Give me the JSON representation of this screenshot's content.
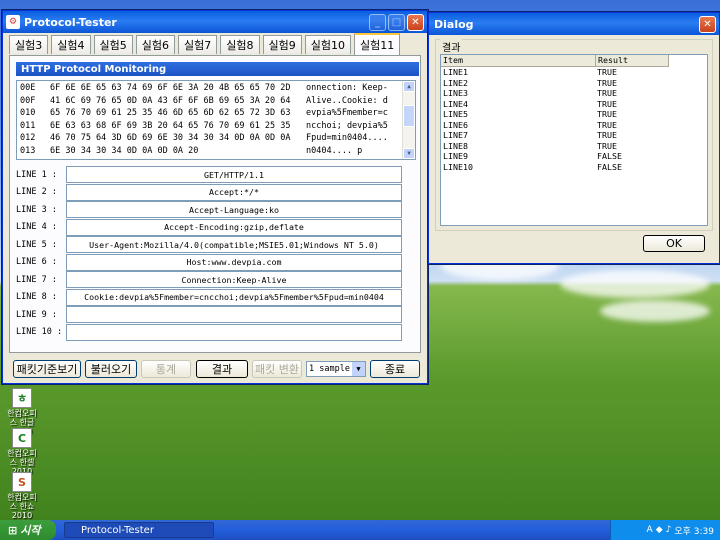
{
  "main_window": {
    "title": "Protocol-Tester",
    "tabs": [
      "실험3",
      "실험4",
      "실험5",
      "실험6",
      "실험7",
      "실험8",
      "실험9",
      "실험10",
      "실험11"
    ],
    "active_tab": 8,
    "monitor_title": "HTTP Protocol Monitoring",
    "hex_rows": [
      {
        "off": "00E",
        "bytes": "6F 6E 6E 65 63 74 69 6F 6E 3A 20 4B 65 65 70 2D",
        "ascii": "onnection: Keep-"
      },
      {
        "off": "00F",
        "bytes": "41 6C 69 76 65 0D 0A 43 6F 6F 6B 69 65 3A 20 64",
        "ascii": "Alive..Cookie: d"
      },
      {
        "off": "010",
        "bytes": "65 76 70 69 61 25 35 46 6D 65 6D 62 65 72 3D 63",
        "ascii": "evpia%5Fmember=c"
      },
      {
        "off": "011",
        "bytes": "6E 63 63 68 6F 69 3B 20 64 65 76 70 69 61 25 35",
        "ascii": "ncchoi; devpia%5"
      },
      {
        "off": "012",
        "bytes": "46 70 75 64 3D 6D 69 6E 30 34 30 34 0D 0A 0D 0A",
        "ascii": "Fpud=min0404...."
      },
      {
        "off": "013",
        "bytes": "6E 30 34 30 34 0D 0A 0D 0A 20",
        "ascii": "n0404.... p"
      }
    ],
    "lines": [
      {
        "label": "LINE 1 :",
        "value": "GET/HTTP/1.1"
      },
      {
        "label": "LINE 2 :",
        "value": "Accept:*/*"
      },
      {
        "label": "LINE 3 :",
        "value": "Accept-Language:ko"
      },
      {
        "label": "LINE 4 :",
        "value": "Accept-Encoding:gzip,deflate"
      },
      {
        "label": "LINE 5 :",
        "value": "User-Agent:Mozilla/4.0(compatible;MSIE5.01;Windows NT 5.0)"
      },
      {
        "label": "LINE 6 :",
        "value": "Host:www.devpia.com"
      },
      {
        "label": "LINE 7 :",
        "value": "Connection:Keep-Alive"
      },
      {
        "label": "LINE 8 :",
        "value": "Cookie:devpia%5Fmember=cncchoi;devpia%5Fmember%5Fpud=min0404"
      },
      {
        "label": "LINE 9 :",
        "value": ""
      },
      {
        "label": "LINE 10 :",
        "value": ""
      }
    ],
    "buttons": {
      "packet_view": "패킷기준보기",
      "load": "불러오기",
      "stats": "통계",
      "result": "결과",
      "packet_convert": "패킷 변환",
      "sample_select": "1 sample",
      "exit": "종료"
    }
  },
  "dialog": {
    "title": "Dialog",
    "group_label": "결과",
    "columns": [
      "Item",
      "Result"
    ],
    "rows": [
      {
        "item": "LINE1",
        "result": "TRUE"
      },
      {
        "item": "LINE2",
        "result": "TRUE"
      },
      {
        "item": "LINE3",
        "result": "TRUE"
      },
      {
        "item": "LINE4",
        "result": "TRUE"
      },
      {
        "item": "LINE5",
        "result": "TRUE"
      },
      {
        "item": "LINE6",
        "result": "TRUE"
      },
      {
        "item": "LINE7",
        "result": "TRUE"
      },
      {
        "item": "LINE8",
        "result": "TRUE"
      },
      {
        "item": "LINE9",
        "result": "FALSE"
      },
      {
        "item": "LINE10",
        "result": "FALSE"
      }
    ],
    "ok_label": "OK"
  },
  "desktop_icons": [
    {
      "label": "한컴오피스 한글 2010",
      "glyph": "ㅎ"
    },
    {
      "label": "한컴오피스 한셀 2010",
      "glyph": "C"
    },
    {
      "label": "한컴오피스 한쇼 2010",
      "glyph": "S"
    }
  ],
  "taskbar": {
    "start_label": "시작",
    "task_label": "Protocol-Tester",
    "clock": "오후 3:39"
  }
}
